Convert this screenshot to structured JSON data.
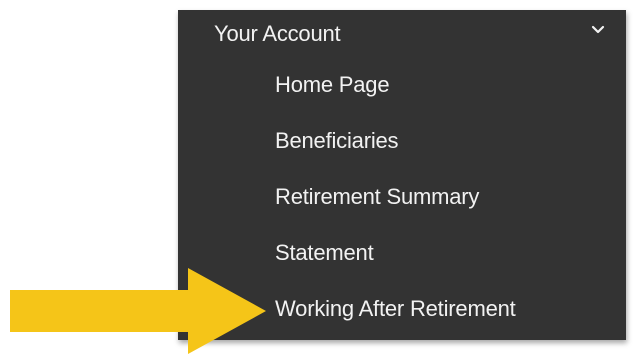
{
  "menu": {
    "header_label": "Your Account",
    "header_icon": "chevron-down-icon",
    "items": [
      {
        "label": "Home Page"
      },
      {
        "label": "Beneficiaries"
      },
      {
        "label": "Retirement Summary"
      },
      {
        "label": "Statement"
      },
      {
        "label": "Working After Retirement"
      }
    ]
  },
  "callout": {
    "icon": "arrow-right-icon",
    "color": "#f5c518"
  },
  "colors": {
    "menu_background": "#333333",
    "menu_text": "#f2f2f2",
    "page_background": "#ffffff"
  }
}
